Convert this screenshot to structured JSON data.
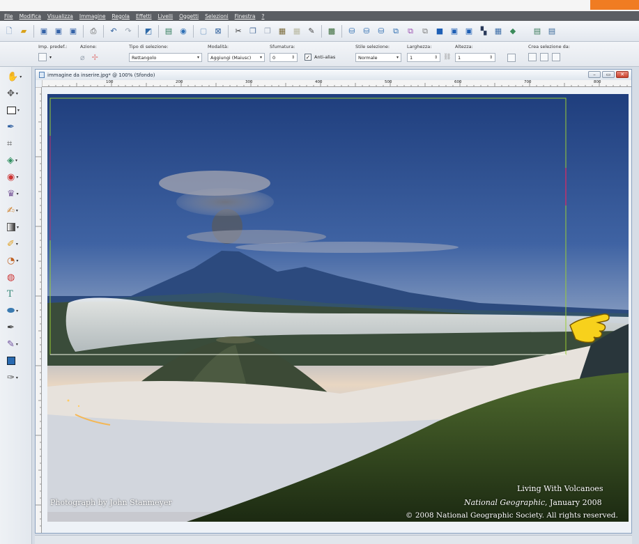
{
  "menu": [
    "File",
    "Modifica",
    "Visualizza",
    "Immagine",
    "Regola",
    "Effetti",
    "Livelli",
    "Oggetti",
    "Selezioni",
    "Finestra",
    "?"
  ],
  "options": {
    "preset_label": "Imp. predef.:",
    "action_label": "Azione:",
    "selection_type_label": "Tipo di selezione:",
    "selection_type_value": "Rettangolo",
    "mode_label": "Modalità:",
    "mode_value": "Aggiungi (Maiusc)",
    "feather_label": "Sfumatura:",
    "feather_value": "0",
    "antialias_label": "Anti-alias",
    "antialias_checked": true,
    "selection_style_label": "Stile selezione:",
    "selection_style_value": "Normale",
    "width_label": "Larghezza:",
    "width_value": "1",
    "height_label": "Altezza:",
    "height_value": "1",
    "create_from_label": "Crea selezione da:"
  },
  "document": {
    "title": "immagine da inserire.jpg* @ 100% (Sfondo)",
    "ruler_numbers": [
      "100",
      "200",
      "300",
      "400",
      "500",
      "600",
      "700",
      "800"
    ]
  },
  "image_caption": {
    "credit": "Photograph by John Stanmeyer",
    "title": "Living With Volcanoes",
    "publication": "National Geographic",
    "date": ", January 2008",
    "copyright": "© 2008 National Geographic Society. All rights reserved."
  },
  "colors": {
    "menubar": "#5b5e63",
    "accent": "#f07c22",
    "selection": "#9acd32"
  }
}
